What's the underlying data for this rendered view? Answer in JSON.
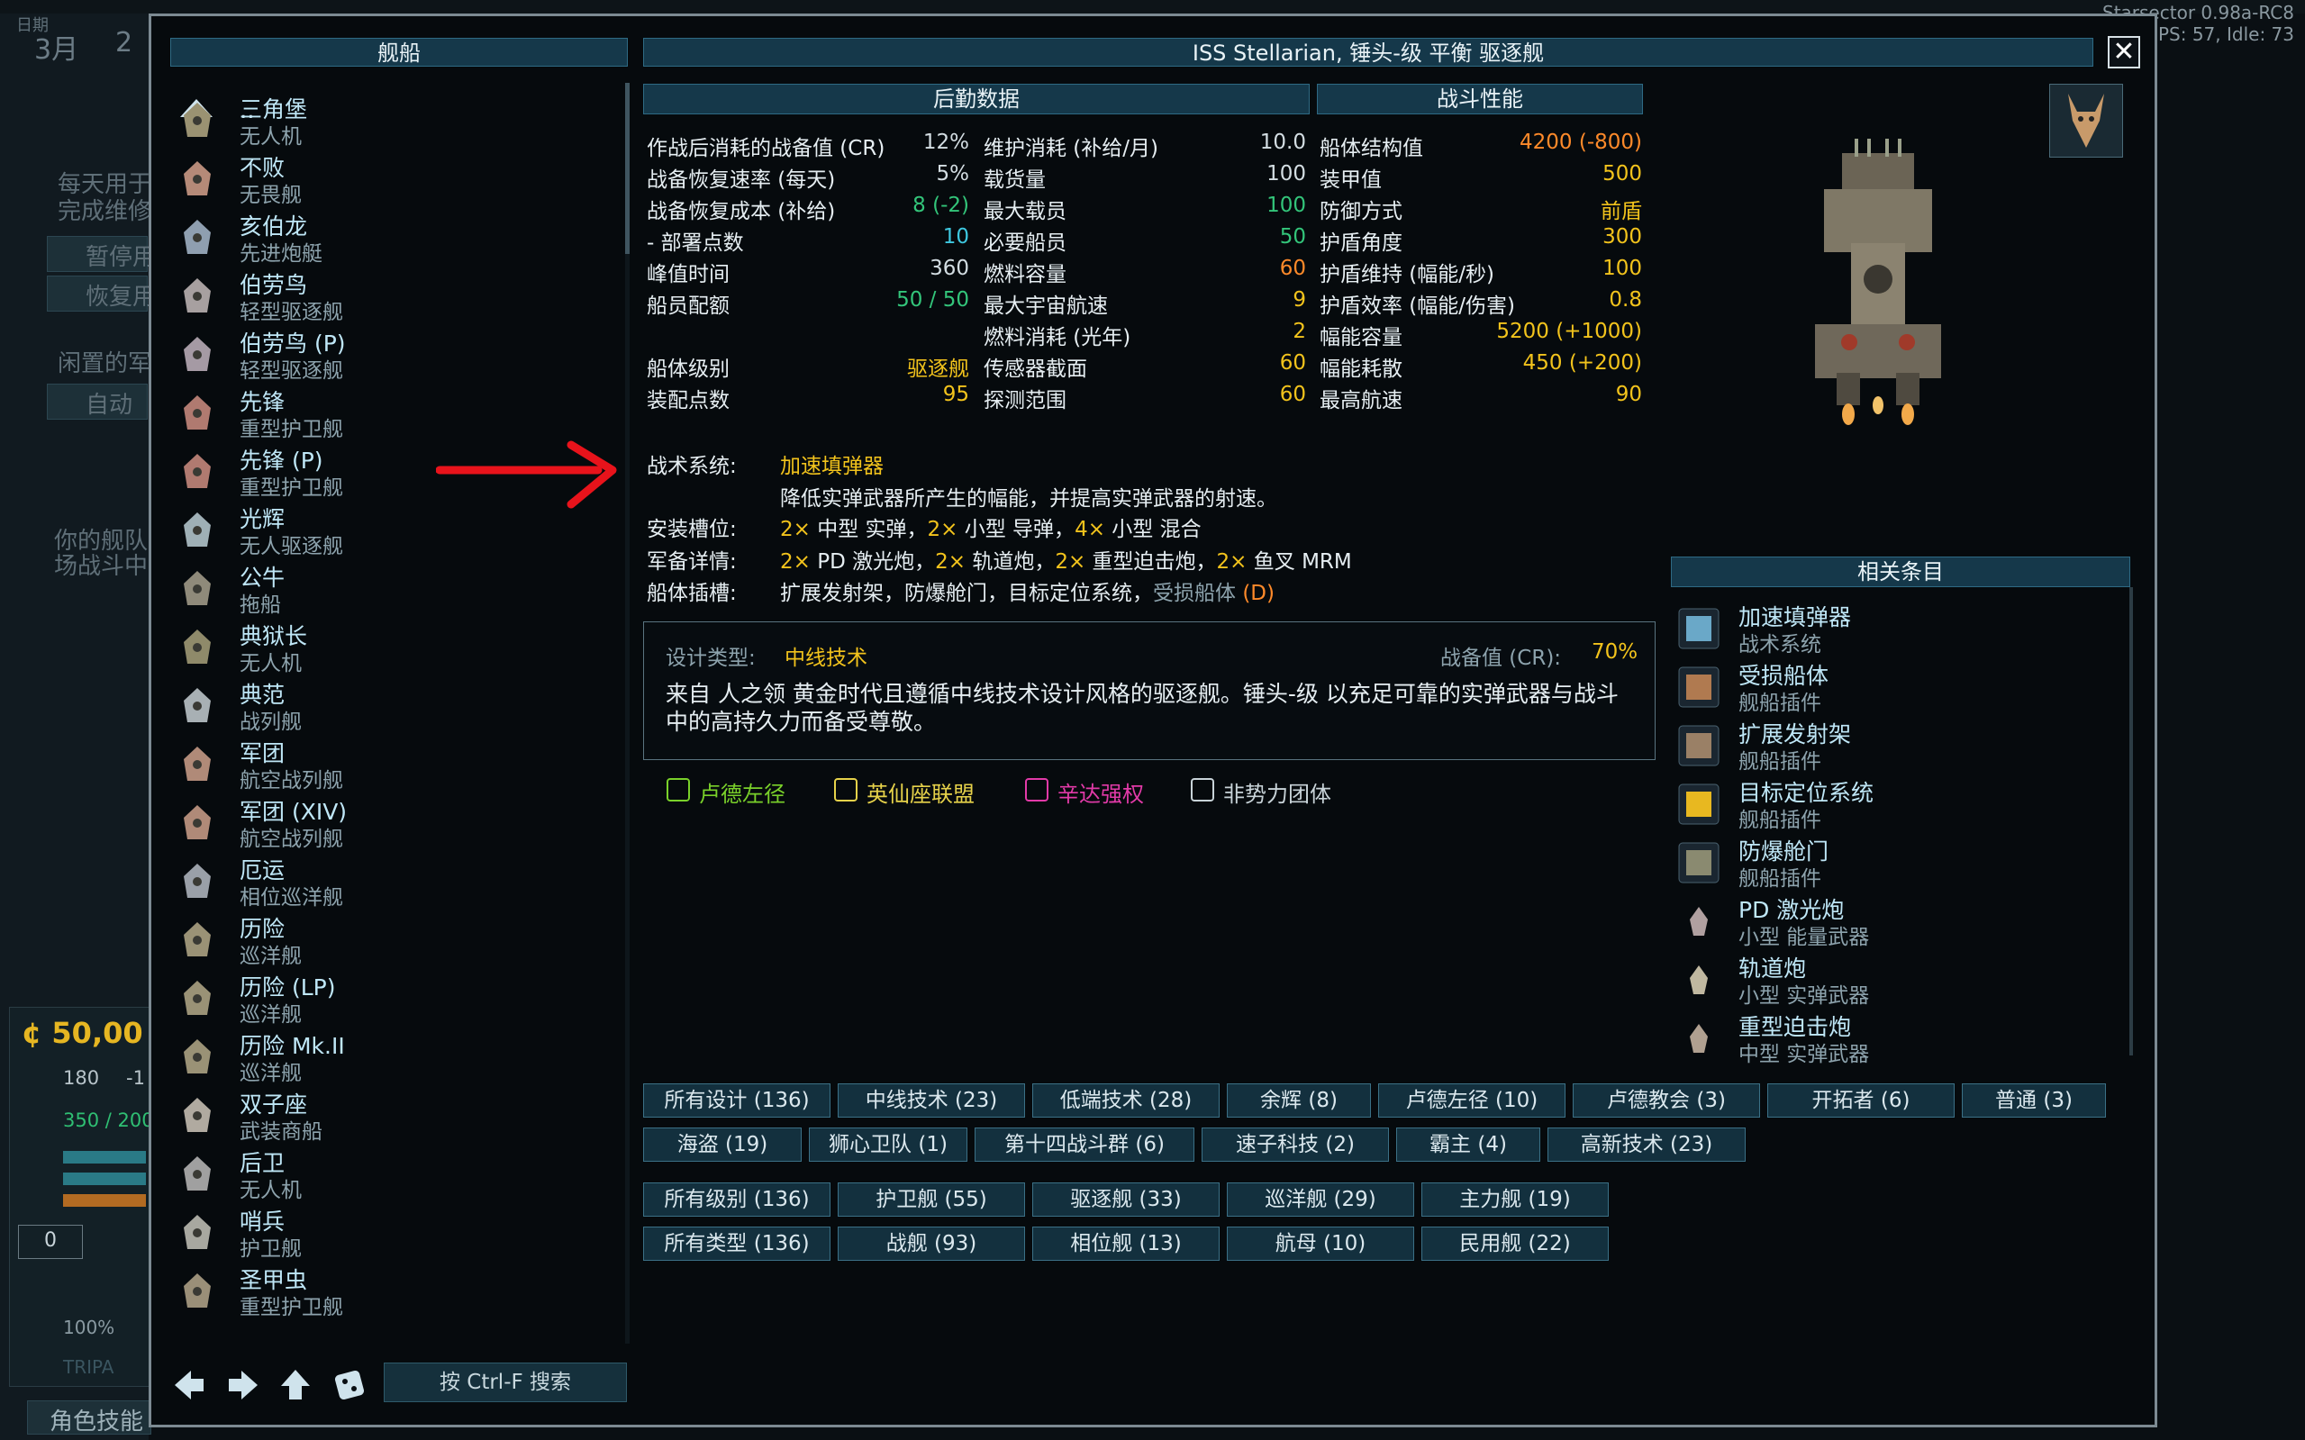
{
  "background": {
    "date_label": "日期",
    "date_value": "3月",
    "date_value2": "2",
    "left_text_1": "每天用于",
    "left_text_2": "完成维修",
    "btn_pause": "暂停用",
    "btn_resume": "恢复用",
    "idle_text": "闲置的军",
    "auto_btn": "自动",
    "fleet_text_1": "你的舰队",
    "fleet_text_2": "场战斗中",
    "credits": "50,00",
    "stat_a": "180",
    "stat_a2": "-1",
    "stat_b": "350 / 200",
    "input_zero": "0",
    "percent": "100%",
    "bottom_btn": "角色技能",
    "tripad": "TRIPA",
    "version_1": "Starsector 0.98a-RC8",
    "version_2": "FPS: 57, Idle: 73"
  },
  "dialog": {
    "ships_header": "舰船",
    "title": "ISS Stellarian, 锤头-级 平衡 驱逐舰",
    "close_label": "✕"
  },
  "ship_list": {
    "up_label": "..",
    "items": [
      {
        "name": "三角堡",
        "type": "无人机"
      },
      {
        "name": "不败",
        "type": "无畏舰"
      },
      {
        "name": "亥伯龙",
        "type": "先进炮艇"
      },
      {
        "name": "伯劳鸟",
        "type": "轻型驱逐舰"
      },
      {
        "name": "伯劳鸟 (P)",
        "type": "轻型驱逐舰"
      },
      {
        "name": "先锋",
        "type": "重型护卫舰"
      },
      {
        "name": "先锋 (P)",
        "type": "重型护卫舰"
      },
      {
        "name": "光辉",
        "type": "无人驱逐舰"
      },
      {
        "name": "公牛",
        "type": "拖船"
      },
      {
        "name": "典狱长",
        "type": "无人机"
      },
      {
        "name": "典范",
        "type": "战列舰"
      },
      {
        "name": "军团",
        "type": "航空战列舰"
      },
      {
        "name": "军团 (XIV)",
        "type": "航空战列舰"
      },
      {
        "name": "厄运",
        "type": "相位巡洋舰"
      },
      {
        "name": "历险",
        "type": "巡洋舰"
      },
      {
        "name": "历险 (LP)",
        "type": "巡洋舰"
      },
      {
        "name": "历险 Mk.II",
        "type": "巡洋舰"
      },
      {
        "name": "双子座",
        "type": "武装商船"
      },
      {
        "name": "后卫",
        "type": "无人机"
      },
      {
        "name": "哨兵",
        "type": "护卫舰"
      },
      {
        "name": "圣甲虫",
        "type": "重型护卫舰"
      }
    ]
  },
  "logistics": {
    "header": "后勤数据",
    "col1": [
      {
        "label": "作战后消耗的战备值 (CR)",
        "value": "12%",
        "color": "default"
      },
      {
        "label": "战备恢复速率 (每天)",
        "value": "5%",
        "color": "default"
      },
      {
        "label": "战备恢复成本 (补给)",
        "value": "8 (-2)",
        "color": "green"
      },
      {
        "label": "- 部署点数",
        "value": "10",
        "color": "cyan"
      },
      {
        "label": "峰值时间",
        "value": "360",
        "color": "default"
      },
      {
        "label": "船员配额",
        "value": "50 / 50",
        "color": "green"
      },
      {
        "label": "",
        "value": "",
        "color": "default"
      },
      {
        "label": "船体级别",
        "value": "驱逐舰",
        "color": "yellow"
      },
      {
        "label": "装配点数",
        "value": "95",
        "color": "yellow"
      }
    ],
    "col2": [
      {
        "label": "维护消耗 (补给/月)",
        "value": "10.0",
        "color": "default"
      },
      {
        "label": "载货量",
        "value": "100",
        "color": "default"
      },
      {
        "label": "最大载员",
        "value": "100",
        "color": "green"
      },
      {
        "label": "必要船员",
        "value": "50",
        "color": "green"
      },
      {
        "label": "燃料容量",
        "value": "60",
        "color": "orange"
      },
      {
        "label": "最大宇宙航速",
        "value": "9",
        "color": "yellow"
      },
      {
        "label": "燃料消耗 (光年)",
        "value": "2",
        "color": "yellow"
      },
      {
        "label": "传感器截面",
        "value": "60",
        "color": "yellow"
      },
      {
        "label": "探测范围",
        "value": "60",
        "color": "yellow"
      }
    ]
  },
  "combat": {
    "header": "战斗性能",
    "stats": [
      {
        "label": "船体结构值",
        "value": "4200 (-800)",
        "color": "orange"
      },
      {
        "label": "装甲值",
        "value": "500",
        "color": "yellow"
      },
      {
        "label": "防御方式",
        "value": "前盾",
        "color": "yellow"
      },
      {
        "label": "护盾角度",
        "value": "300",
        "color": "yellow"
      },
      {
        "label": "护盾维持 (幅能/秒)",
        "value": "100",
        "color": "yellow"
      },
      {
        "label": "护盾效率 (幅能/伤害)",
        "value": "0.8",
        "color": "yellow"
      },
      {
        "label": "幅能容量",
        "value": "5200 (+1000)",
        "color": "yellow"
      },
      {
        "label": "幅能耗散",
        "value": "450 (+200)",
        "color": "yellow"
      },
      {
        "label": "最高航速",
        "value": "90",
        "color": "yellow"
      }
    ]
  },
  "details": {
    "tactical_label": "战术系统:",
    "tactical_value": "加速填弹器",
    "tactical_desc": "降低实弹武器所产生的幅能，并提高实弹武器的射速。",
    "mounts_label": "安装槽位:",
    "mounts": [
      {
        "count": "2×",
        "text": " 中型 实弹，"
      },
      {
        "count": "2×",
        "text": " 小型 导弹，"
      },
      {
        "count": "4×",
        "text": " 小型 混合"
      }
    ],
    "armaments_label": "军备详情:",
    "armaments": [
      {
        "count": "2×",
        "text": " PD 激光炮，"
      },
      {
        "count": "2×",
        "text": " 轨道炮，"
      },
      {
        "count": "2×",
        "text": " 重型迫击炮，"
      },
      {
        "count": "2×",
        "text": " 鱼叉 MRM"
      }
    ],
    "hullmods_label": "船体插槽:",
    "hullmods_text": "扩展发射架，防爆舱门，目标定位系统，",
    "hullmods_dmod": "受损船体",
    "hullmods_dmod_tag": "(D)",
    "design_label": "设计类型:",
    "design_value": "中线技术",
    "cr_label": "战备值 (CR):",
    "cr_value": "70%",
    "description": "来自 人之领 黄金时代且遵循中线技术设计风格的驱逐舰。锤头-级 以充足可靠的实弹武器与战斗中的高持久力而备受尊敬。"
  },
  "factions": [
    {
      "name": "卢德左径",
      "color": "#7ad12a"
    },
    {
      "name": "英仙座联盟",
      "color": "#e6d24a"
    },
    {
      "name": "辛达强权",
      "color": "#e23aa8"
    },
    {
      "name": "非势力团体",
      "color": "#c8d3d8"
    }
  ],
  "related": {
    "header": "相关条目",
    "items": [
      {
        "name": "加速填弹器",
        "type": "战术系统"
      },
      {
        "name": "受损船体",
        "type": "舰船插件"
      },
      {
        "name": "扩展发射架",
        "type": "舰船插件"
      },
      {
        "name": "目标定位系统",
        "type": "舰船插件"
      },
      {
        "name": "防爆舱门",
        "type": "舰船插件"
      },
      {
        "name": "PD 激光炮",
        "type": "小型 能量武器"
      },
      {
        "name": "轨道炮",
        "type": "小型 实弹武器"
      },
      {
        "name": "重型迫击炮",
        "type": "中型 实弹武器"
      }
    ]
  },
  "filters": {
    "row1": [
      "所有设计 (136)",
      "中线技术 (23)",
      "低端技术 (28)",
      "余辉 (8)",
      "卢德左径 (10)",
      "卢德教会 (3)",
      "开拓者 (6)",
      "普通 (3)"
    ],
    "row2": [
      "海盗 (19)",
      "狮心卫队 (1)",
      "第十四战斗群 (6)",
      "速子科技 (2)",
      "霸主 (4)",
      "高新技术 (23)"
    ],
    "row3": [
      "所有级别 (136)",
      "护卫舰 (55)",
      "驱逐舰 (33)",
      "巡洋舰 (29)",
      "主力舰 (19)"
    ],
    "row4": [
      "所有类型 (136)",
      "战舰 (93)",
      "相位舰 (13)",
      "航母 (10)",
      "民用舰 (22)"
    ]
  },
  "bottom": {
    "search_label": "按 Ctrl-F 搜索"
  },
  "colors": {
    "header_bg": "#15384a",
    "accent_yellow": "#f2c31c",
    "accent_green": "#33c57a",
    "accent_cyan": "#3ec8e0",
    "accent_orange": "#ff8a2a",
    "annotation_arrow": "#e8131b"
  }
}
